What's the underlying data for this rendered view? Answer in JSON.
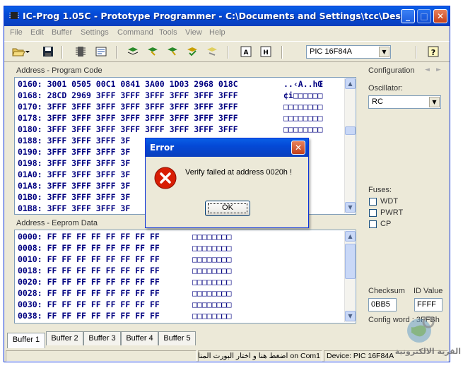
{
  "window": {
    "title": "IC-Prog 1.05C - Prototype Programmer - C:\\Documents and Settings\\tcc\\Desktop\\NI..."
  },
  "menu": [
    "File",
    "Edit",
    "Buffer",
    "Settings",
    "Command",
    "Tools",
    "View",
    "Help"
  ],
  "toolbar": {
    "device_select": "PIC 16F84A",
    "icons": [
      "open-icon",
      "save-icon",
      "chip-icon",
      "config-icon",
      "read-icon",
      "program-icon",
      "erase-icon",
      "verify-icon",
      "blank-check-icon",
      "view-asm-icon",
      "view-hex-icon",
      "help-icon"
    ]
  },
  "program_code": {
    "label": "Address - Program Code",
    "rows": [
      {
        "addr": "0160:",
        "words": "3001 0505 00C1 0841 3A00 1D03 2968 018C",
        "ascii": "..‹A..hŒ"
      },
      {
        "addr": "0168:",
        "words": "28CD 2969 3FFF 3FFF 3FFF 3FFF 3FFF 3FFF",
        "ascii": "¢i□□□□□□"
      },
      {
        "addr": "0170:",
        "words": "3FFF 3FFF 3FFF 3FFF 3FFF 3FFF 3FFF 3FFF",
        "ascii": "□□□□□□□□"
      },
      {
        "addr": "0178:",
        "words": "3FFF 3FFF 3FFF 3FFF 3FFF 3FFF 3FFF 3FFF",
        "ascii": "□□□□□□□□"
      },
      {
        "addr": "0180:",
        "words": "3FFF 3FFF 3FFF 3FFF 3FFF 3FFF 3FFF 3FFF",
        "ascii": "□□□□□□□□"
      },
      {
        "addr": "0188:",
        "words": "3FFF 3FFF 3FFF 3F",
        "ascii": ""
      },
      {
        "addr": "0190:",
        "words": "3FFF 3FFF 3FFF 3F",
        "ascii": ""
      },
      {
        "addr": "0198:",
        "words": "3FFF 3FFF 3FFF 3F",
        "ascii": ""
      },
      {
        "addr": "01A0:",
        "words": "3FFF 3FFF 3FFF 3F",
        "ascii": ""
      },
      {
        "addr": "01A8:",
        "words": "3FFF 3FFF 3FFF 3F",
        "ascii": ""
      },
      {
        "addr": "01B0:",
        "words": "3FFF 3FFF 3FFF 3F",
        "ascii": ""
      },
      {
        "addr": "01B8:",
        "words": "3FFF 3FFF 3FFF 3F",
        "ascii": ""
      }
    ]
  },
  "eeprom_data": {
    "label": "Address - Eeprom Data",
    "rows": [
      {
        "addr": "0000:",
        "bytes": "FF FF FF FF FF FF FF FF",
        "ascii": "□□□□□□□□"
      },
      {
        "addr": "0008:",
        "bytes": "FF FF FF FF FF FF FF FF",
        "ascii": "□□□□□□□□"
      },
      {
        "addr": "0010:",
        "bytes": "FF FF FF FF FF FF FF FF",
        "ascii": "□□□□□□□□"
      },
      {
        "addr": "0018:",
        "bytes": "FF FF FF FF FF FF FF FF",
        "ascii": "□□□□□□□□"
      },
      {
        "addr": "0020:",
        "bytes": "FF FF FF FF FF FF FF FF",
        "ascii": "□□□□□□□□"
      },
      {
        "addr": "0028:",
        "bytes": "FF FF FF FF FF FF FF FF",
        "ascii": "□□□□□□□□"
      },
      {
        "addr": "0030:",
        "bytes": "FF FF FF FF FF FF FF FF",
        "ascii": "□□□□□□□□"
      },
      {
        "addr": "0038:",
        "bytes": "FF FF FF FF FF FF FF FF",
        "ascii": "□□□□□□□□"
      }
    ]
  },
  "configuration": {
    "label": "Configuration",
    "oscillator_label": "Oscillator:",
    "oscillator_value": "RC",
    "fuses_label": "Fuses:",
    "fuses": [
      {
        "name": "WDT",
        "checked": false
      },
      {
        "name": "PWRT",
        "checked": false
      },
      {
        "name": "CP",
        "checked": false
      }
    ],
    "checksum_label": "Checksum",
    "checksum_value": "0BB5",
    "id_value_label": "ID Value",
    "id_value": "FFFF",
    "config_word_label": "Config word : 3FFBh"
  },
  "tabs": [
    "Buffer 1",
    "Buffer 2",
    "Buffer 3",
    "Buffer 4",
    "Buffer 5"
  ],
  "active_tab": "Buffer 1",
  "status": {
    "port": "on Com1 اضغط هنا و اختار البورت المناسب",
    "device": "Device: PIC 16F84A"
  },
  "dialog": {
    "title": "Error",
    "message": "Verify failed at address 0020h !",
    "ok_label": "OK"
  },
  "watermark": {
    "text": "القرية الالكترونية"
  },
  "colors": {
    "titlebar": "#0449d6",
    "hex_text": "#000080",
    "error_red": "#d81e05"
  }
}
